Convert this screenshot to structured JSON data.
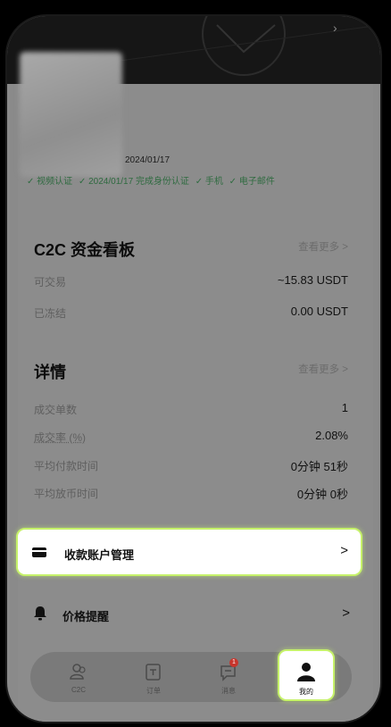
{
  "profile": {
    "date": "2024/01/17",
    "verifications": [
      "✓ 视频认证",
      "✓ 2024/01/17 完成身份认证",
      "✓ 手机",
      "✓ 电子邮件"
    ]
  },
  "funds": {
    "title": "C2C 资金看板",
    "see_more": "查看更多 >",
    "rows": [
      {
        "label": "可交易",
        "value": "~15.83 USDT"
      },
      {
        "label": "已冻结",
        "value": "0.00 USDT"
      }
    ]
  },
  "details": {
    "title": "详情",
    "see_more": "查看更多 >",
    "rows": [
      {
        "label": "成交单数",
        "value": "1"
      },
      {
        "label": "成交率 (%)",
        "value": "2.08%"
      },
      {
        "label": "平均付款时间",
        "value": "0分钟 51秒"
      },
      {
        "label": "平均放币时间",
        "value": "0分钟 0秒"
      }
    ]
  },
  "menu": {
    "payment": {
      "label": "收款账户管理",
      "chevron": ">",
      "icon": "card-icon"
    },
    "price_alert": {
      "label": "价格提醒",
      "chevron": ">",
      "icon": "bell-icon"
    }
  },
  "tabs": [
    {
      "label": "C2C",
      "icon": "users-icon"
    },
    {
      "label": "订单",
      "icon": "order-icon"
    },
    {
      "label": "消息",
      "icon": "message-icon",
      "badge": "1"
    },
    {
      "label": "我的",
      "icon": "person-icon",
      "active": true
    }
  ],
  "colors": {
    "highlight": "#c6f26a",
    "verify_green": "#2f6b40",
    "badge_red": "#c7352c"
  }
}
